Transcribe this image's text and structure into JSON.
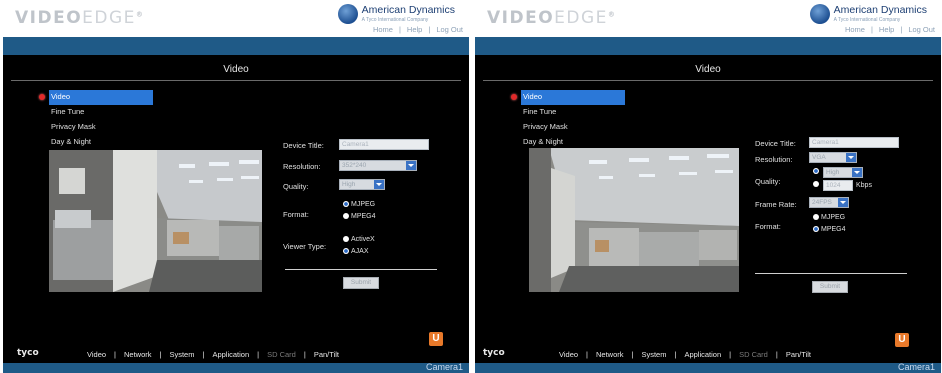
{
  "left": {
    "logo": {
      "main": "VIDEO",
      "light": "EDGE",
      "mark": "®"
    },
    "brand": {
      "name": "American Dynamics",
      "sub": "A Tyco International Company"
    },
    "toplinks": [
      "Home",
      "Help",
      "Log Out"
    ],
    "page_title": "Video",
    "menu": [
      {
        "label": "Video",
        "active": true
      },
      {
        "label": "Fine Tune",
        "active": false
      },
      {
        "label": "Privacy Mask",
        "active": false
      },
      {
        "label": "Day & Night",
        "active": false
      }
    ],
    "form": {
      "device_title_label": "Device Title:",
      "device_title_value": "Camera1",
      "resolution_label": "Resolution:",
      "resolution_value": "352*240",
      "quality_label": "Quality:",
      "quality_value": "High",
      "format_label": "Format:",
      "format_options": [
        {
          "label": "MJPEG",
          "checked": true
        },
        {
          "label": "MPEG4",
          "checked": false
        }
      ],
      "viewer_type_label": "Viewer Type:",
      "viewer_type_options": [
        {
          "label": "ActiveX",
          "checked": false
        },
        {
          "label": "AJAX",
          "checked": true
        }
      ],
      "submit_label": "Submit"
    },
    "bottom_nav": [
      "Video",
      "Network",
      "System",
      "Application",
      "SD Card",
      "Pan/Tilt"
    ],
    "bottom_nav_disabled": [
      "SD Card"
    ],
    "tyco": "tyco",
    "badge": "U",
    "camera_label": "Camera1"
  },
  "right": {
    "logo": {
      "main": "VIDEO",
      "light": "EDGE",
      "mark": "®"
    },
    "brand": {
      "name": "American Dynamics",
      "sub": "A Tyco International Company"
    },
    "toplinks": [
      "Home",
      "Help",
      "Log Out"
    ],
    "page_title": "Video",
    "menu": [
      {
        "label": "Video",
        "active": true
      },
      {
        "label": "Fine Tune",
        "active": false
      },
      {
        "label": "Privacy Mask",
        "active": false
      },
      {
        "label": "Day & Night",
        "active": false
      }
    ],
    "form": {
      "device_title_label": "Device Title:",
      "device_title_value": "Camera1",
      "resolution_label": "Resolution:",
      "resolution_value": "VGA",
      "quality_label": "Quality:",
      "quality_options": [
        {
          "label": "High",
          "checked": true
        },
        {
          "label": "1024",
          "checked": false
        }
      ],
      "bitrate_unit": "Kbps",
      "frame_rate_label": "Frame Rate:",
      "frame_rate_value": "24FPS",
      "format_label": "Format:",
      "format_options": [
        {
          "label": "MJPEG",
          "checked": false
        },
        {
          "label": "MPEG4",
          "checked": true
        }
      ],
      "submit_label": "Submit"
    },
    "bottom_nav": [
      "Video",
      "Network",
      "System",
      "Application",
      "SD Card",
      "Pan/Tilt"
    ],
    "bottom_nav_disabled": [
      "SD Card"
    ],
    "tyco": "tyco",
    "badge": "U",
    "camera_label": "Camera1"
  },
  "colors": {
    "accent_blue": "#1f5a87",
    "menu_active": "#2b78d8",
    "badge_orange": "#e8792a",
    "bullet_red": "#e02a2a"
  }
}
